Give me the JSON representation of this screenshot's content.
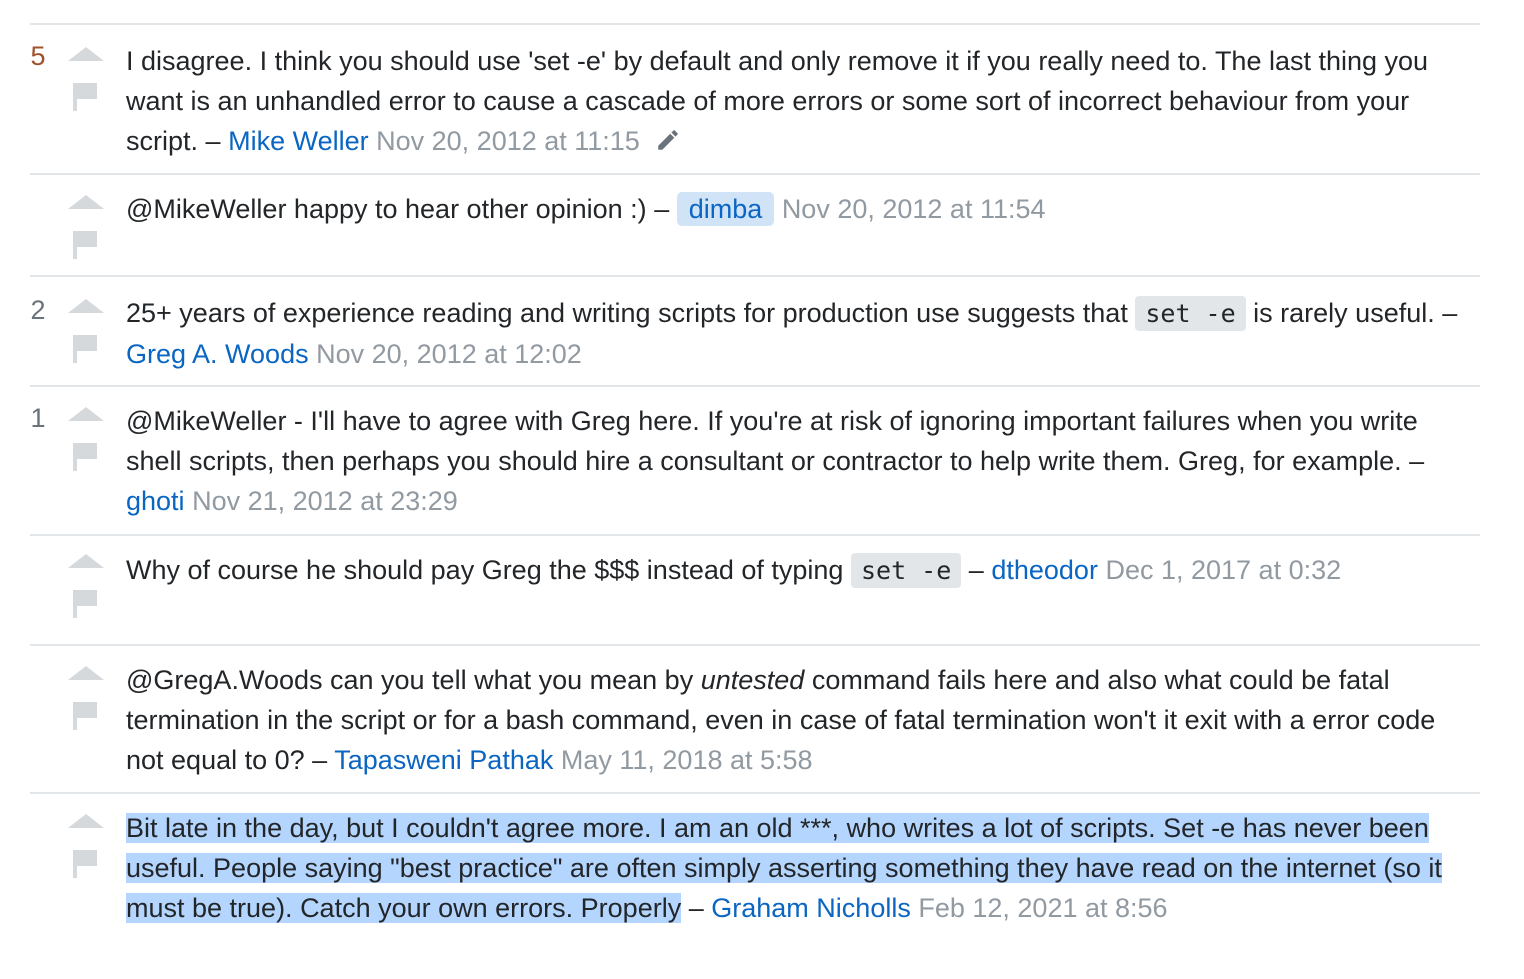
{
  "comments": [
    {
      "score": "5",
      "text": "I disagree. I think you should use 'set -e' by default and only remove it if you really need to. The last thing you want is an unhandled error to cause a cascade of more errors or some sort of incorrect behaviour from your script.",
      "dash": "–",
      "user": "Mike Weller",
      "date": "Nov 20, 2012 at 11:15",
      "edited_icon": "pencil-icon"
    },
    {
      "score": "",
      "text": "@MikeWeller happy to hear other opinion :)",
      "dash": "–",
      "user": "dimba",
      "date": "Nov 20, 2012 at 11:54"
    },
    {
      "score": "2",
      "text_before": "25+ years of experience reading and writing scripts for production use suggests that",
      "code": "set -e",
      "text_after": "is rarely useful.",
      "dash": "–",
      "user": "Greg A. Woods",
      "date": "Nov 20, 2012 at 12:02"
    },
    {
      "score": "1",
      "text": "@MikeWeller - I'll have to agree with Greg here. If you're at risk of ignoring important failures when you write shell scripts, then perhaps you should hire a consultant or contractor to help write them. Greg, for example.",
      "dash": "–",
      "user": "ghoti",
      "date": "Nov 21, 2012 at 23:29"
    },
    {
      "score": "",
      "text_before": "Why of course he should pay Greg the $$$ instead of typing",
      "code": "set -e",
      "dash": "–",
      "user": "dtheodor",
      "date": "Dec 1, 2017 at 0:32"
    },
    {
      "score": "",
      "text_before": "@GregA.Woods can you tell what you mean by",
      "emphasis": "untested",
      "text_after": "command fails here and also what could be fatal termination in the script or for a bash command, even in case of fatal termination won't it exit with a error code not equal to 0?",
      "dash": "–",
      "user": "Tapasweni Pathak",
      "date": "May 11, 2018 at 5:58"
    },
    {
      "score": "",
      "text": "Bit late in the day, but I couldn't agree more. I am an old ***, who writes a lot of scripts. Set -e has never been useful. People saying \"best practice\" are often simply asserting something they have read on the internet (so it must be true). Catch your own errors. Properly",
      "dash": "–",
      "user": "Graham Nicholls",
      "date": "Feb 12, 2021 at 8:56"
    }
  ],
  "icons": {
    "upvote": "upvote-arrow-icon",
    "flag": "flag-icon"
  },
  "colors": {
    "link": "#0a66c2",
    "date": "#9199a1",
    "hot_score": "#a0522d",
    "selection": "#b4d5fe",
    "op_highlight": "#d0e3f7"
  }
}
